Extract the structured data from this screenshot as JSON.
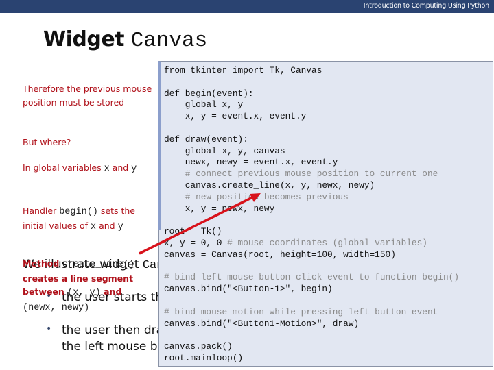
{
  "header": {
    "course_title": "Introduction to Computing Using Python",
    "bar_color": "#2a4371"
  },
  "slide": {
    "title_word": "Widget",
    "title_code": "Canvas"
  },
  "underlying_slide": {
    "intro_text": "We illustrate widget",
    "intro_code": "Can",
    "bullet1": "the user starts th",
    "bullet2_line1": "the user then dra",
    "bullet2_line2": "the left mouse bu",
    "bullet_glyph": "•"
  },
  "notes": {
    "note1": "Therefore the previous mouse position must be stored",
    "note2": "But where?",
    "note3_prefix": "In global variables ",
    "note3_x": "x",
    "note3_and": " and ",
    "note3_y": "y",
    "note4_prefix": "Handler ",
    "note4_code": "begin()",
    "note4_mid": " sets the initial values of ",
    "note4_x": "x",
    "note4_and": " and ",
    "note4_y": "y",
    "note5_prefix": "Method ",
    "note5_code": "create_line()",
    "note5_mid": "creates a line segment between ",
    "note5_xy": "(x, y)",
    "note5_and": " and",
    "note5_newxy": "(newx, newy)",
    "text_color": "#b0121b"
  },
  "code": {
    "lines": [
      {
        "text": "from tkinter import Tk, Canvas",
        "comment": false
      },
      {
        "text": "",
        "comment": false
      },
      {
        "text": "def begin(event):",
        "comment": false
      },
      {
        "text": "    global x, y",
        "comment": false
      },
      {
        "text": "    x, y = event.x, event.y",
        "comment": false
      },
      {
        "text": "",
        "comment": false
      },
      {
        "text": "def draw(event):",
        "comment": false
      },
      {
        "text": "    global x, y, canvas",
        "comment": false
      },
      {
        "text": "    newx, newy = event.x, event.y",
        "comment": false
      },
      {
        "text": "    # connect previous mouse position to current one",
        "comment": true
      },
      {
        "text": "    canvas.create_line(x, y, newx, newy)",
        "comment": false
      },
      {
        "text": "    # new position becomes previous",
        "comment": true
      },
      {
        "text": "    x, y = newx, newy",
        "comment": false
      },
      {
        "text": "",
        "comment": false
      },
      {
        "text": "root = Tk()",
        "comment": false
      },
      {
        "text": "x, y = 0, 0 ",
        "comment": false,
        "trailing_comment": "# mouse coordinates (global variables)"
      },
      {
        "text": "canvas = Canvas(root, height=100, width=150)",
        "comment": false
      },
      {
        "text": "",
        "comment": false
      },
      {
        "text": "# bind left mouse button click event to function begin()",
        "comment": true
      },
      {
        "text": "canvas.bind(\"<Button-1>\", begin)",
        "comment": false
      },
      {
        "text": "",
        "comment": false
      },
      {
        "text": "# bind mouse motion while pressing left button event",
        "comment": true
      },
      {
        "text": "canvas.bind(\"<Button1-Motion>\", draw)",
        "comment": false
      },
      {
        "text": "",
        "comment": false
      },
      {
        "text": "canvas.pack()",
        "comment": false
      },
      {
        "text": "root.mainloop()",
        "comment": false
      }
    ],
    "background": "#e2e7f2"
  },
  "annotation": {
    "arrow_color": "#d8121b",
    "arrow_target": "canvas.create_line(x, y, newx, newy)"
  }
}
